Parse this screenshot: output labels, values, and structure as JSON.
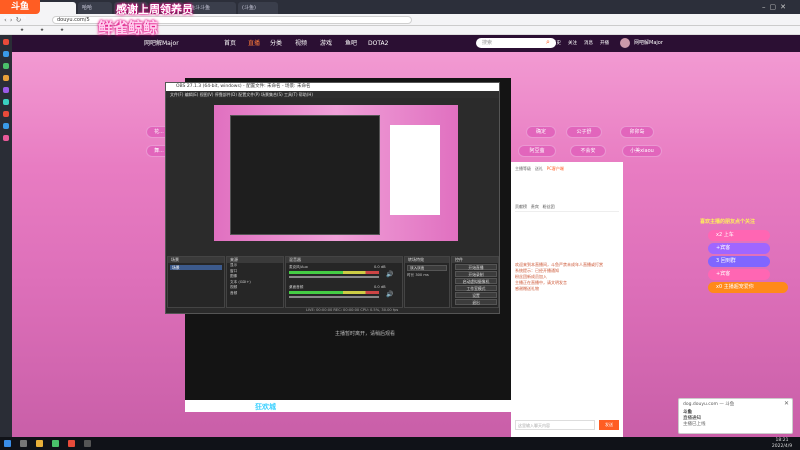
{
  "browser": {
    "tabs": [
      {
        "label": "斗鱼"
      },
      {
        "label": "哈哈"
      },
      {
        "label": "直播"
      },
      {
        "label": "鱼"
      },
      {
        "label": "鱼斗斗鱼"
      },
      {
        "label": "(斗鱼)"
      }
    ],
    "url": "douyu.com/5"
  },
  "site": {
    "logo_text": "斗鱼",
    "logo_sub": "douyu.com",
    "nav": [
      {
        "label": "首页"
      },
      {
        "label": "直播"
      },
      {
        "label": "分类"
      },
      {
        "label": "视频"
      },
      {
        "label": "游戏"
      },
      {
        "label": "鱼吧"
      },
      {
        "label": "DOTA2"
      }
    ],
    "streamer_name": "网吧解Major",
    "search_placeholder": "搜索",
    "header_right": [
      {
        "label": "下载"
      },
      {
        "label": "历史"
      },
      {
        "label": "关注"
      },
      {
        "label": "消息"
      },
      {
        "label": "开播"
      }
    ]
  },
  "overlay": {
    "promo_line1": "感谢上周领养员",
    "promo_line2": "鲜雀鲸鲸"
  },
  "menu_pills_left": [
    {
      "label": "花..."
    },
    {
      "label": "舞..."
    }
  ],
  "menu_pills_right": [
    {
      "label": "确定"
    },
    {
      "label": "公子舒"
    },
    {
      "label": "卯卯岛"
    },
    {
      "label": "阿豆萤"
    },
    {
      "label": "不会安"
    },
    {
      "label": "小美xiaou"
    }
  ],
  "obs": {
    "title": "OBS 27.1.3 (64-bit, windows) - 配置文件: 未命名 - 场景: 未命名",
    "menu": "文件(F)  编辑(E)  视图(V)  停靠部件(D)  配置文件(P)  场景集合(S)  工具(T)  帮助(H)",
    "docks": [
      {
        "title": "场景"
      },
      {
        "title": "来源"
      },
      {
        "title": "混音器"
      },
      {
        "title": "转场特效"
      },
      {
        "title": "控件"
      }
    ],
    "scene_item": "场景",
    "sources": [
      "显示",
      "窗口",
      "图像",
      "文本 (GDI+)",
      "视频",
      "音频"
    ],
    "mixer_tracks": [
      {
        "label": "麦克风/Aux",
        "db": "0.0 dB"
      },
      {
        "label": "桌面音频",
        "db": "0.0 dB"
      }
    ],
    "controls": [
      {
        "label": "开始直播"
      },
      {
        "label": "开始录制"
      },
      {
        "label": "启动虚拟摄像机"
      },
      {
        "label": "工作室模式"
      },
      {
        "label": "设置"
      },
      {
        "label": "退出"
      }
    ],
    "transition": {
      "label": "淡入淡出",
      "duration_label": "时长",
      "duration": "300 ms"
    },
    "status": "LIVE: 00:00:00   REC: 00:00:00   CPU: 0.5%, 30.00 fps"
  },
  "player": {
    "center_text": "主播暂时离开，请稍后观看",
    "bottom_label": "狂欢城"
  },
  "chat": {
    "stats": [
      {
        "label": "主播等级"
      },
      {
        "label": "送礼"
      },
      {
        "label": "PC客户端"
      }
    ],
    "tabs": [
      {
        "label": "贡献榜"
      },
      {
        "label": "贵宾"
      },
      {
        "label": "粉丝团"
      }
    ],
    "lines": [
      "欢迎来到本直播间，斗鱼严禁未成年人直播或打赏",
      "系统提示：已经开播通知",
      "粉丝团新成员加入",
      "主播正在直播中，请文明发言",
      "感谢赠送礼物"
    ],
    "input_placeholder": "这里输入聊天内容",
    "send_label": "发送"
  },
  "right_badges": [
    {
      "label": "x2 上车",
      "color": "#ff66b3"
    },
    {
      "label": "+宾客",
      "color": "#a066ff"
    },
    {
      "label": "3 回到群",
      "color": "#8066ff"
    },
    {
      "label": "+宾客",
      "color": "#ff66b3"
    },
    {
      "label": "x0 主播超宠爱你",
      "color": "#ff8a1a"
    }
  ],
  "right_header": "喜欢主播的朋友点个关注",
  "toast": {
    "site": "dog.douyu.com — 斗鱼",
    "title": "斗鱼",
    "body": "直播通知",
    "footer": "主播已上线"
  },
  "taskbar": {
    "time": "18:21",
    "date": "2022/4/9"
  },
  "colors": {
    "brand": "#ff5d23",
    "pink": "#e265bc",
    "obs_bg": "#2b2b2b"
  }
}
